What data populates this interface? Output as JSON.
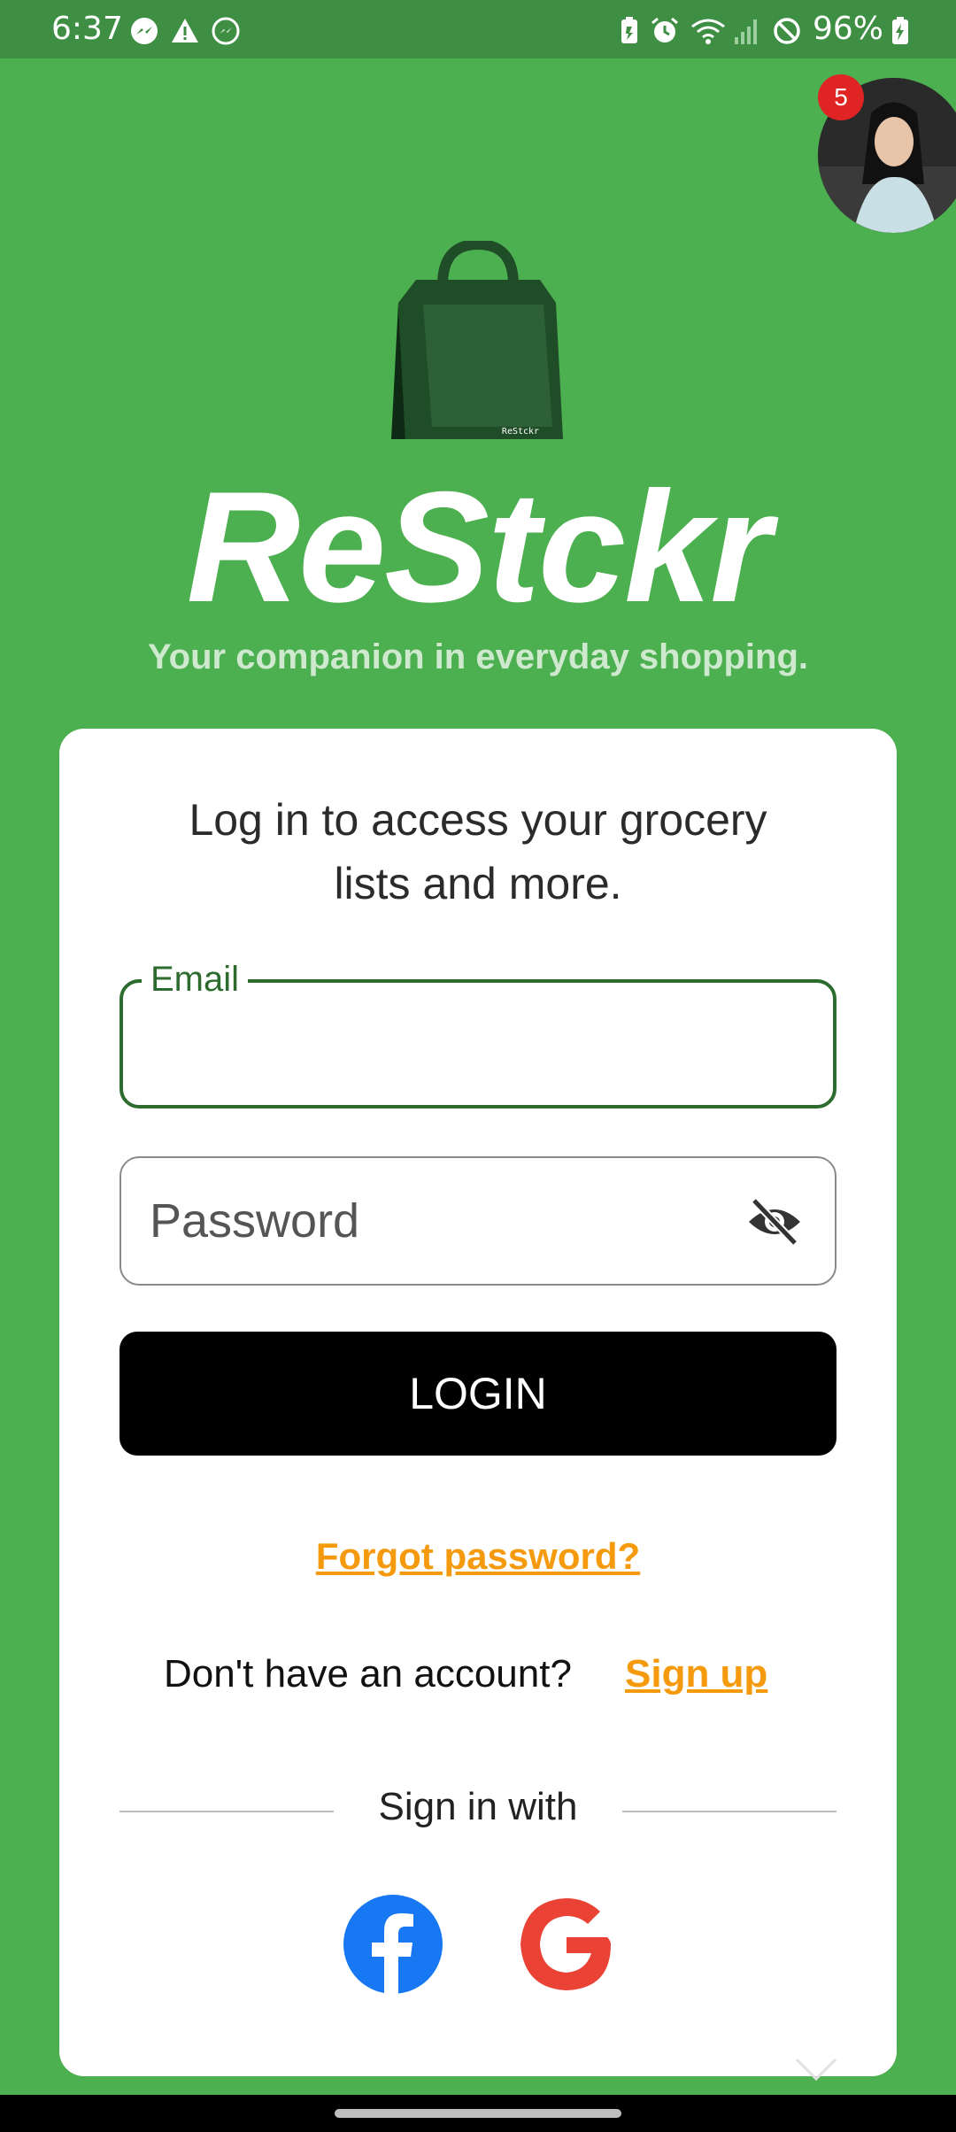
{
  "status_bar": {
    "time": "6:37",
    "battery": "96%",
    "left_icons": [
      "messenger-icon",
      "alert-icon",
      "messenger-outline-icon"
    ],
    "right_icons": [
      "battery-saver-icon",
      "alarm-icon",
      "wifi-icon",
      "signal-icon",
      "do-not-disturb-icon",
      "battery-icon"
    ]
  },
  "chat_head": {
    "badge": "5"
  },
  "brand": {
    "logo_text": "ReStckr",
    "title": "ReStckr",
    "tagline": "Your companion in everyday shopping."
  },
  "login_card": {
    "intro": "Log in to access your grocery lists and more.",
    "email_label": "Email",
    "email_value": "",
    "password_placeholder": "Password",
    "login_button": "LOGIN",
    "forgot_password": "Forgot password?",
    "no_account": "Don't have an account?",
    "sign_up": "Sign up",
    "sign_in_with": "Sign in with"
  },
  "social": [
    {
      "icon": "facebook-icon",
      "color": "#1877f2"
    },
    {
      "icon": "google-icon",
      "color": "#ea4335"
    }
  ],
  "colors": {
    "background": "#4caf50",
    "status_bar": "#3e8e43",
    "accent": "#f59a0c",
    "field_focus": "#2e6b2f",
    "button": "#000000"
  }
}
